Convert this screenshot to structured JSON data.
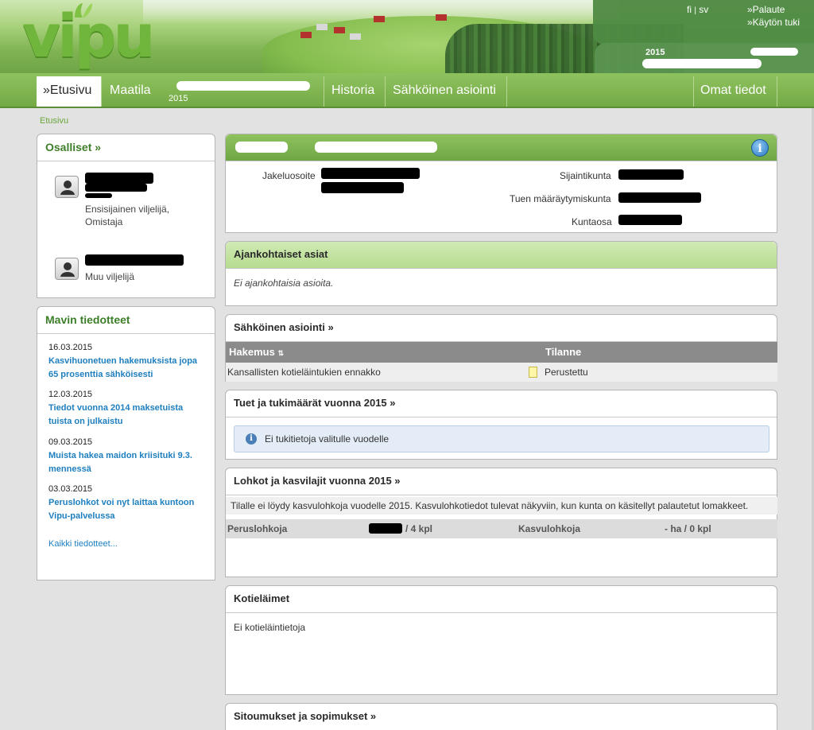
{
  "header": {
    "logo_text": "vipu",
    "lang_fi": "fi",
    "lang_sep": "|",
    "lang_sv": "sv",
    "link_feedback": "»Palaute",
    "link_support": "»Käytön tuki",
    "year": "2015"
  },
  "nav": {
    "items": [
      {
        "label": "»Etusivu"
      },
      {
        "label": "Maatila"
      },
      {
        "label": "Historia"
      },
      {
        "label": "Sähköinen asiointi"
      },
      {
        "label": "Omat tiedot"
      }
    ],
    "maatila_sub": "2015"
  },
  "breadcrumb": "Etusivu",
  "osalliset": {
    "title": "Osalliset »",
    "persons": [
      {
        "role": "Ensisijainen viljelijä,",
        "role2": "Omistaja"
      },
      {
        "role": "Muu viljelijä"
      }
    ]
  },
  "mavi": {
    "title": "Mavin tiedotteet",
    "news": [
      {
        "date": "16.03.2015",
        "title": "Kasvihuonetuen hakemuksista jopa 65 prosenttia sähköisesti"
      },
      {
        "date": "12.03.2015",
        "title": "Tiedot vuonna 2014 maksetuista tuista on julkaistu"
      },
      {
        "date": "09.03.2015",
        "title": "Muista hakea maidon kriisituki 9.3. mennessä"
      },
      {
        "date": "03.03.2015",
        "title": "Peruslohkot voi nyt laittaa kuntoon Vipu-palvelussa"
      }
    ],
    "all_link": "Kaikki tiedotteet..."
  },
  "farm_info": {
    "info_icon": "i",
    "labels": {
      "jakeluosoite": "Jakeluosoite",
      "sijaintikunta": "Sijaintikunta",
      "tuen": "Tuen määräytymiskunta",
      "kuntaosa": "Kuntaosa"
    }
  },
  "ajankohtaiset": {
    "title": "Ajankohtaiset asiat",
    "text": "Ei ajankohtaisia asioita."
  },
  "asiointi": {
    "title": "Sähköinen asiointi »",
    "columns": [
      "Hakemus",
      "Tilanne"
    ],
    "sort_icon": "⇅",
    "rows": [
      {
        "hakemus": "Kansallisten kotieläintukien ennakko",
        "tilanne": "Perustettu"
      }
    ]
  },
  "tuet": {
    "title": "Tuet ja tukimäärät vuonna 2015 »",
    "notice": "Ei tukitietoja valitulle vuodelle",
    "notice_icon": "i"
  },
  "lohkot": {
    "title": "Lohkot ja kasvilajit vuonna 2015 »",
    "message": "Tilalle ei löydy kasvulohkoja vuodelle 2015. Kasvulohkotiedot tulevat näkyviin, kun kunta on käsitellyt palautetut lomakkeet.",
    "peruslohkoja_label": "Peruslohkoja",
    "peruslohkoja_value": "/ 4 kpl",
    "kasvulohkoja_label": "Kasvulohkoja",
    "kasvulohkoja_value": "- ha / 0 kpl"
  },
  "kotielaimet": {
    "title": "Kotieläimet",
    "text": "Ei kotieläintietoja"
  },
  "sitoumukset": {
    "title": "Sitoumukset ja sopimukset »"
  }
}
